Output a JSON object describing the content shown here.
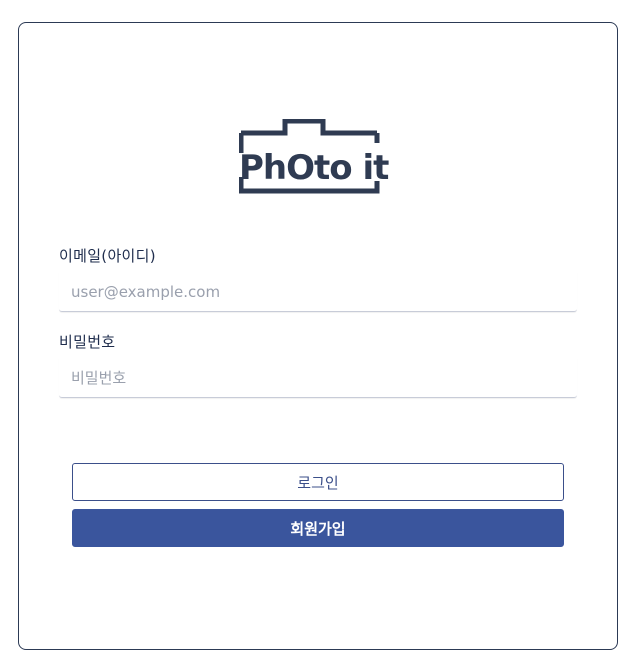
{
  "logo": {
    "text": "PhOto it",
    "icon": "camera-logo-icon",
    "color": "#2f3b52"
  },
  "email": {
    "label": "이메일(아이디)",
    "placeholder": "user@example.com",
    "value": ""
  },
  "password": {
    "label": "비밀번호",
    "placeholder": "비밀번호",
    "value": ""
  },
  "buttons": {
    "login_label": "로그인",
    "signup_label": "회원가입"
  },
  "colors": {
    "primary": "#3a559d",
    "border": "#2c3a55",
    "label": "#1f2d4d"
  }
}
